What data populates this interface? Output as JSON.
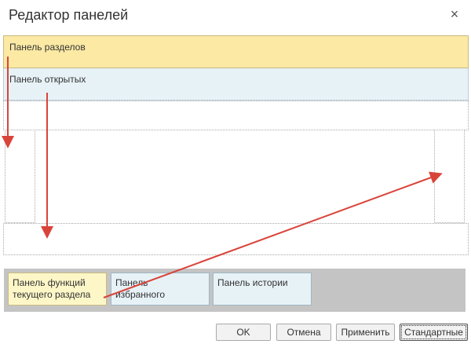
{
  "window": {
    "title": "Редактор панелей",
    "close_glyph": "×"
  },
  "panels": {
    "sections_label": "Панель разделов",
    "open_label": "Панель открытых"
  },
  "available_panels": [
    {
      "line1": "Панель функций",
      "line2": "текущего раздела"
    },
    {
      "line1": "Панель",
      "line2": "избранного"
    },
    {
      "line1": "Панель истории",
      "line2": ""
    }
  ],
  "buttons": {
    "ok": "OK",
    "cancel": "Отмена",
    "apply": "Применить",
    "default": "Стандартные"
  },
  "colors": {
    "sections_panel": "#fbe9a4",
    "open_panel": "#e7f2f7",
    "function_tile": "#fdf7c8",
    "arrow": "#d9443a",
    "tray": "#c4c4c4"
  }
}
